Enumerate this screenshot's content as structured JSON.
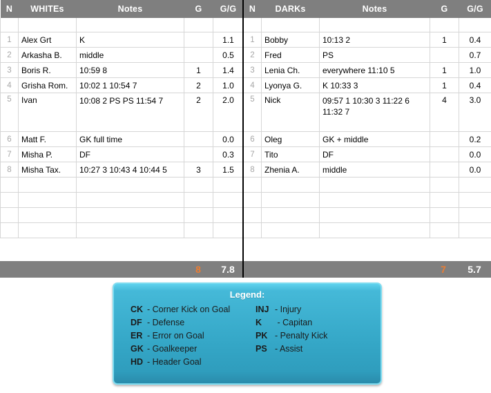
{
  "columns": {
    "n": "N",
    "notes": "Notes",
    "g": "G",
    "gg": "G/G"
  },
  "teams": [
    {
      "name": "WHITEs",
      "rows": [
        {
          "n": "1",
          "player": "Alex Grt",
          "notes": [
            "K"
          ],
          "g": "",
          "gg": "1.1",
          "tall": false
        },
        {
          "n": "2",
          "player": "Arkasha B.",
          "notes": [
            "middle"
          ],
          "g": "",
          "gg": "0.5",
          "tall": false
        },
        {
          "n": "3",
          "player": "Boris R.",
          "notes": [
            "10:59 8"
          ],
          "g": "1",
          "gg": "1.4",
          "tall": false
        },
        {
          "n": "4",
          "player": "Grisha Rom.",
          "notes": [
            "10:02 1    10:54 7"
          ],
          "g": "2",
          "gg": "1.0",
          "tall": false
        },
        {
          "n": "5",
          "player": "Ivan",
          "notes": [
            "10:08 2  PS   PS  11:54 7"
          ],
          "g": "2",
          "gg": "2.0",
          "tall": true
        },
        {
          "n": "6",
          "player": "Matt F.",
          "notes": [
            "GK full time"
          ],
          "g": "",
          "gg": "0.0",
          "tall": false
        },
        {
          "n": "7",
          "player": "Misha P.",
          "notes": [
            "DF"
          ],
          "g": "",
          "gg": "0.3",
          "tall": false
        },
        {
          "n": "8",
          "player": "Misha Tax.",
          "notes": [
            "10:27 3  10:43 4  10:44 5"
          ],
          "g": "3",
          "gg": "1.5",
          "tall": false
        }
      ],
      "empty_rows": 4,
      "total_g": "8",
      "total_gg": "7.8"
    },
    {
      "name": "DARKs",
      "rows": [
        {
          "n": "1",
          "player": "Bobby",
          "notes": [
            "10:13 2"
          ],
          "g": "1",
          "gg": "0.4",
          "tall": false
        },
        {
          "n": "2",
          "player": "Fred",
          "notes": [
            "PS"
          ],
          "g": "",
          "gg": "0.7",
          "tall": false
        },
        {
          "n": "3",
          "player": "Lenia Ch.",
          "notes": [
            "everywhere  11:10 5"
          ],
          "g": "1",
          "gg": "1.0",
          "tall": false
        },
        {
          "n": "4",
          "player": "Lyonya G.",
          "notes": [
            "K  10:33 3"
          ],
          "g": "1",
          "gg": "0.4",
          "tall": false
        },
        {
          "n": "5",
          "player": "Nick",
          "notes": [
            "09:57 1  10:30  3  11:22 6",
            "11:32 7"
          ],
          "g": "4",
          "gg": "3.0",
          "tall": true
        },
        {
          "n": "6",
          "player": "Oleg",
          "notes": [
            "GK + middle"
          ],
          "g": "",
          "gg": "0.2",
          "tall": false
        },
        {
          "n": "7",
          "player": "Tito",
          "notes": [
            "DF"
          ],
          "g": "",
          "gg": "0.0",
          "tall": false
        },
        {
          "n": "8",
          "player": "Zhenia A.",
          "notes": [
            "middle"
          ],
          "g": "",
          "gg": "0.0",
          "tall": false
        }
      ],
      "empty_rows": 4,
      "total_g": "7",
      "total_gg": "5.7"
    }
  ],
  "legend": {
    "title": "Legend:",
    "left_column": [
      {
        "abbr": "CK",
        "desc": "- Corner Kick on Goal"
      },
      {
        "abbr": "DF",
        "desc": "- Defense"
      },
      {
        "abbr": "ER",
        "desc": "- Error on Goal"
      },
      {
        "abbr": "GK",
        "desc": "- Goalkeeper"
      },
      {
        "abbr": "HD",
        "desc": "- Header Goal"
      }
    ],
    "right_column": [
      {
        "abbr": "INJ",
        "desc": "- Injury"
      },
      {
        "abbr": "K",
        "desc": " - Capitan"
      },
      {
        "abbr": "PK",
        "desc": "- Penalty Kick"
      },
      {
        "abbr": "PS",
        "desc": "- Assist"
      }
    ]
  },
  "colors": {
    "header_gray": "#7f7f7f",
    "gg_yellow": "#ffffa8",
    "total_g_orange": "#ed7d31",
    "legend_cyan": "#34a6c6",
    "legend_border": "#7fdcf0"
  }
}
